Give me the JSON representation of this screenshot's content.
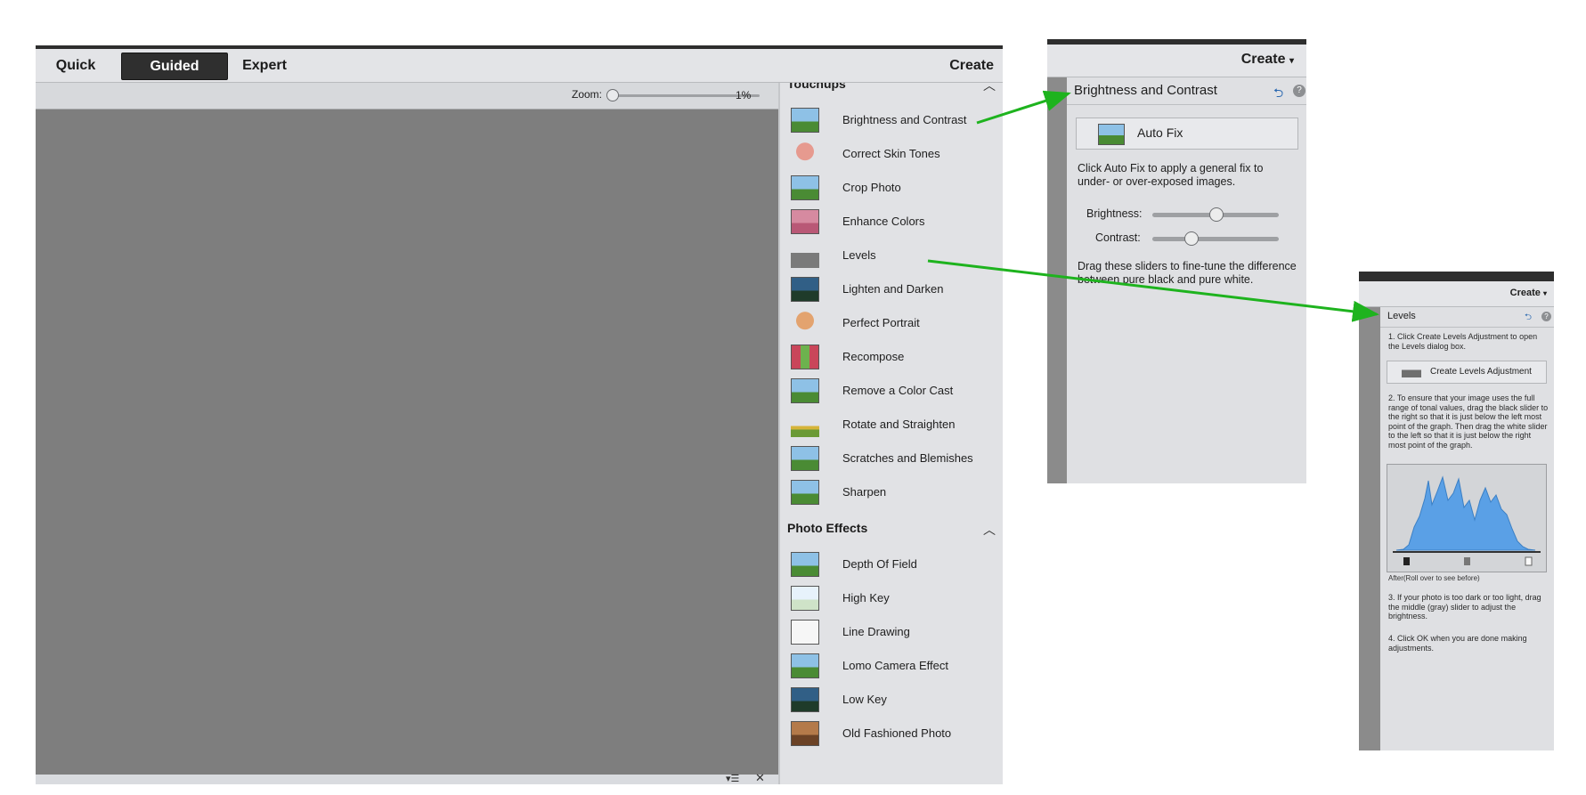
{
  "main": {
    "modes": [
      "Quick",
      "Guided",
      "Expert"
    ],
    "active_mode": "Guided",
    "create_label": "Create",
    "zoom_label": "Zoom:",
    "zoom_value": "1%",
    "touchups_title": "Touchups",
    "touchups": [
      "Brightness and Contrast",
      "Correct Skin Tones",
      "Crop Photo",
      "Enhance Colors",
      "Levels",
      "Lighten and Darken",
      "Perfect Portrait",
      "Recompose",
      "Remove a Color Cast",
      "Rotate and Straighten",
      "Scratches and Blemishes",
      "Sharpen"
    ],
    "effects_title": "Photo Effects",
    "effects": [
      "Depth Of Field",
      "High Key",
      "Line Drawing",
      "Lomo Camera Effect",
      "Low Key",
      "Old Fashioned Photo"
    ]
  },
  "bc": {
    "create_label": "Create",
    "title": "Brightness and Contrast",
    "autofix_label": "Auto Fix",
    "description": "Click Auto Fix to apply a general fix to under- or over-exposed images.",
    "brightness_label": "Brightness:",
    "contrast_label": "Contrast:",
    "brightness_level": 0.5,
    "contrast_level": 0.3,
    "drag_text": "Drag these sliders to fine-tune the difference between pure black and pure white."
  },
  "levels": {
    "create_label": "Create",
    "title": "Levels",
    "step1": "1. Click Create Levels Adjustment to open the Levels dialog box.",
    "button_label": "Create Levels Adjustment",
    "step2": "2. To ensure that your image uses the full range of tonal values, drag the black slider to the right so that it is just below the left most point of the graph. Then drag the white slider to the left so that it is just below the right most point of the graph.",
    "after_note": "After(Roll over to see before)",
    "step3": "3. If your photo is too dark or too light, drag the middle (gray) slider to adjust the brightness.",
    "step4": "4. Click OK when you are done making adjustments."
  },
  "colors": {
    "arrow": "#1eb31e",
    "histogram": "#5aa0e6",
    "canvas": "#7e7e7e"
  }
}
